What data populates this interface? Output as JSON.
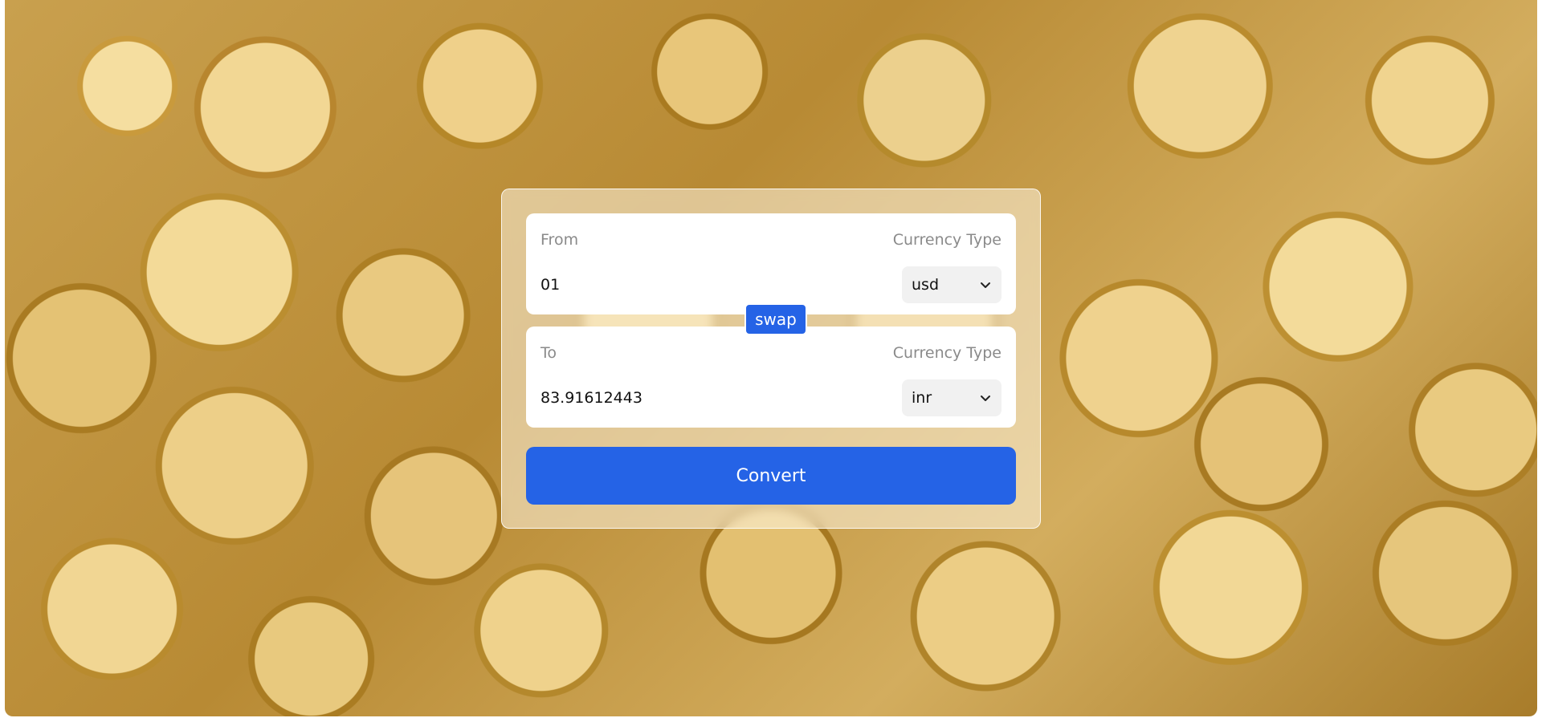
{
  "from_box": {
    "label": "From",
    "currency_type_label": "Currency Type",
    "amount": "01",
    "currency": "usd"
  },
  "swap_button": {
    "label": "swap"
  },
  "to_box": {
    "label": "To",
    "currency_type_label": "Currency Type",
    "amount": "83.91612443",
    "currency": "inr"
  },
  "convert_button": {
    "label": "Convert"
  },
  "colors": {
    "accent": "#2563e6",
    "card_bg": "#ffffff",
    "muted_text": "#8a8a8a"
  },
  "icons": {
    "select_arrow": "chevron-down-icon"
  }
}
